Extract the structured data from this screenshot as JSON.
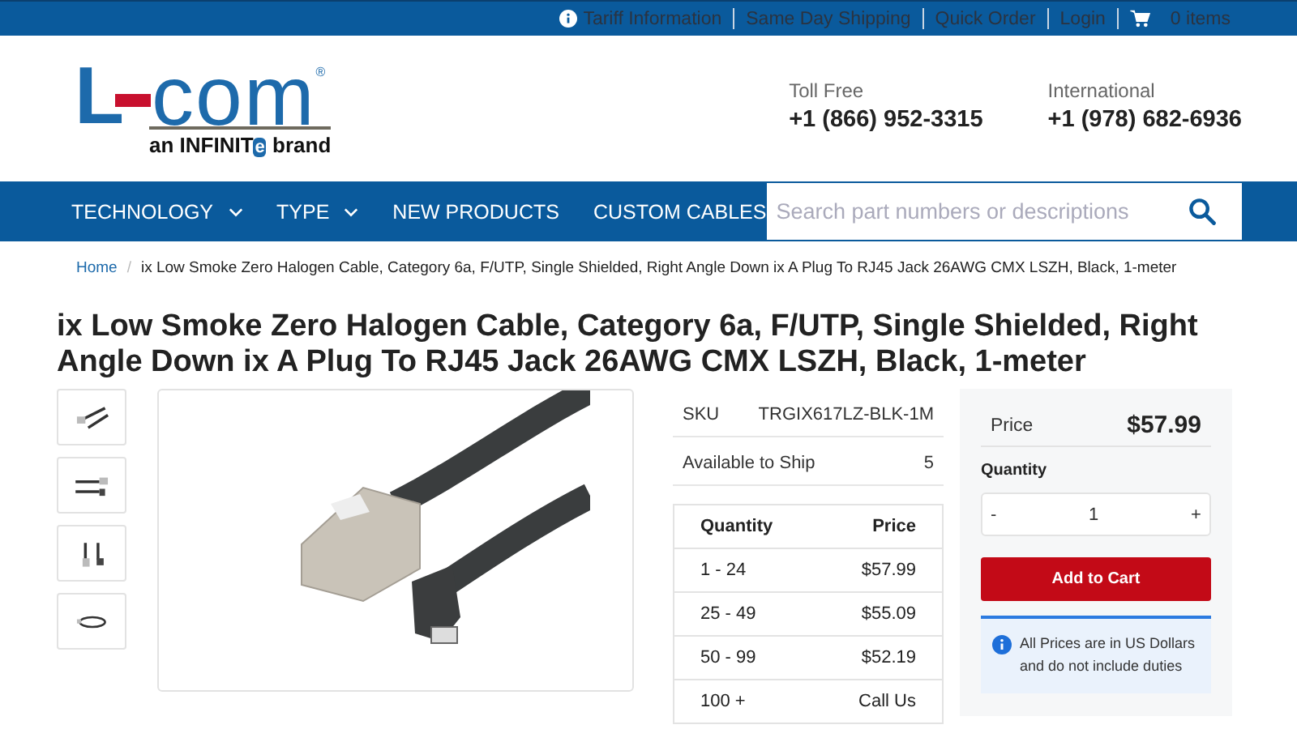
{
  "top_bar": {
    "links": [
      {
        "label": "Tariff Information",
        "kind": "info"
      },
      {
        "label": "Same Day Shipping",
        "kind": "plain"
      },
      {
        "label": "Quick Order",
        "kind": "plain"
      },
      {
        "label": "Login",
        "kind": "plain"
      },
      {
        "label": "0 items",
        "kind": "cart"
      }
    ]
  },
  "logo": {
    "letter": "L",
    "word": "com",
    "mark": "®",
    "tagline_before": "an INFINIT",
    "tagline_badge": "e",
    "tagline_after": "brand"
  },
  "phones": [
    {
      "label": "Toll Free",
      "number": "+1 (866) 952-3315"
    },
    {
      "label": "International",
      "number": "+1 (978) 682-6936"
    }
  ],
  "nav": {
    "items": [
      {
        "label": "TECHNOLOGY",
        "dropdown": true
      },
      {
        "label": "TYPE",
        "dropdown": true
      },
      {
        "label": "NEW PRODUCTS",
        "dropdown": false
      },
      {
        "label": "CUSTOM CABLES",
        "dropdown": false
      }
    ],
    "search": {
      "placeholder": "Search part numbers or descriptions"
    }
  },
  "breadcrumb_separator": "/",
  "breadcrumb": [
    {
      "label": "Home",
      "link": true
    },
    {
      "label": "ix Low Smoke Zero Halogen Cable, Category 6a, F/UTP, Single Shielded, Right Angle Down ix A Plug To RJ45 Jack 26AWG CMX LSZH, Black, 1-meter",
      "link": false
    }
  ],
  "title": "ix Low Smoke Zero Halogen Cable, Category 6a, F/UTP, Single Shielded, Right Angle Down ix A Plug To RJ45 Jack 26AWG CMX LSZH, Black, 1-meter",
  "gallery": {
    "thumbnails": [
      {
        "kind": "angled"
      },
      {
        "kind": "side"
      },
      {
        "kind": "upright"
      },
      {
        "kind": "coiled"
      }
    ]
  },
  "specs": [
    {
      "label": "SKU",
      "value": "TRGIX617LZ-BLK-1M"
    },
    {
      "label": "Available to Ship",
      "value": "5"
    }
  ],
  "price_breaks": {
    "columns": [
      "Quantity",
      "Price"
    ],
    "rows": [
      [
        "1 - 24",
        "$57.99"
      ],
      [
        "25 - 49",
        "$55.09"
      ],
      [
        "50 - 99",
        "$52.19"
      ],
      [
        "100 +",
        "Call Us"
      ]
    ]
  },
  "purchase": {
    "price_label": "Price",
    "price": "$57.99",
    "quantity_label": "Quantity",
    "decrement": "-",
    "quantity": "1",
    "increment": "+",
    "button": "Add to Cart",
    "notice": "All Prices are in US Dollars and do not include duties"
  }
}
